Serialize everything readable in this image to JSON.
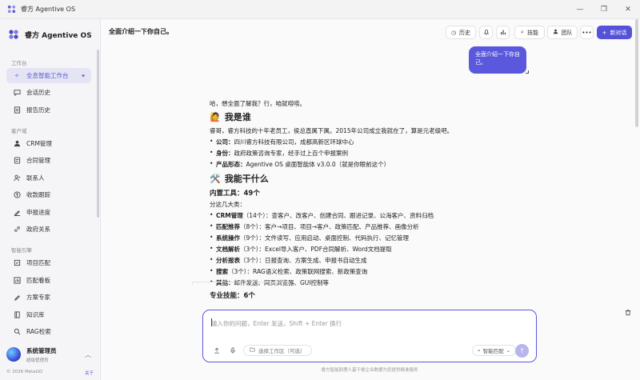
{
  "window": {
    "title": "睿方 Agentive OS",
    "controls": [
      "—",
      "❐",
      "✕"
    ]
  },
  "sidebar": {
    "brand": "睿方 Agentive OS",
    "sections": [
      {
        "label": "工作台",
        "items": [
          {
            "label": "全息智能工作台",
            "icon": "sparkle-icon",
            "active": true
          },
          {
            "label": "会话历史",
            "icon": "chat-icon"
          },
          {
            "label": "报告历史",
            "icon": "report-icon"
          }
        ]
      },
      {
        "label": "客户域",
        "items": [
          {
            "label": "CRM管理",
            "icon": "user-icon"
          },
          {
            "label": "合同管理",
            "icon": "contract-icon"
          },
          {
            "label": "联系人",
            "icon": "contacts-icon"
          },
          {
            "label": "收款跟踪",
            "icon": "payment-icon"
          },
          {
            "label": "申报进度",
            "icon": "progress-icon"
          },
          {
            "label": "政府关系",
            "icon": "link-icon"
          }
        ]
      },
      {
        "label": "智能引擎",
        "items": [
          {
            "label": "项目匹配",
            "icon": "target-icon"
          },
          {
            "label": "匹配看板",
            "icon": "board-icon"
          },
          {
            "label": "方案专家",
            "icon": "expert-icon"
          },
          {
            "label": "知识库",
            "icon": "book-icon"
          },
          {
            "label": "RAG检索",
            "icon": "search-icon"
          }
        ]
      }
    ],
    "user": {
      "name": "系统管理员",
      "role": "超级管理员"
    },
    "copyright": "© 2026 MetaGO",
    "about": "关于"
  },
  "header": {
    "title": "全面介绍一下你自己。",
    "buttons": {
      "history": "历史",
      "skills": "技能",
      "team": "团队",
      "more": "•••",
      "new_chat": "新对话"
    }
  },
  "chat": {
    "user_message": "全面介绍一下你自己。",
    "answer": {
      "intro": "哈，想全面了解我？行，咱就唠唠。",
      "who_emoji": "🙋",
      "who_title": "我是谁",
      "who_text": "睿哥，睿方科技的十年老员工，侯总直属下属。2015年公司成立我就在了，算是元老级吧。",
      "company_label": "公司：",
      "company_value": "四川睿方科技有限公司，成都高新区环球中心",
      "identity_label": "身份：",
      "identity_value": "政府政策咨询专家，经手过上百个申报案例",
      "product_label": "产品形态：",
      "product_value": "Agentive OS 桌面智能体 v3.0.0（就是你眼前这个）",
      "can_emoji": "🛠️",
      "can_title": "我能干什么",
      "tools_title": "内置工具：49个",
      "tools_sub": "分这几大类：",
      "tools": [
        {
          "name": "CRM管理",
          "count": "（14个）",
          "desc": "：查客户、改客户、创建合同、跟进记录、公海客户、资料归档"
        },
        {
          "name": "匹配推荐",
          "count": "（8个）",
          "desc": "：客户→项目、项目→客户、政策匹配、产品推荐、画像分析"
        },
        {
          "name": "系统操作",
          "count": "（9个）",
          "desc": "：文件读写、应用启动、桌面控制、代码执行、记忆管理"
        },
        {
          "name": "文档解析",
          "count": "（3个）",
          "desc": "：Excel导入客户、PDF合同解析、Word文档提取"
        },
        {
          "name": "分析报表",
          "count": "（3个）",
          "desc": "：日报查询、方案生成、申报书自动生成"
        },
        {
          "name": "搜索",
          "count": "（3个）",
          "desc": "：RAG语义检索、政策联网搜索、新政策查询"
        },
        {
          "name": "其他：",
          "count": "",
          "desc": "邮件发送、网页浏览器、GUI控制等"
        }
      ],
      "skills_title": "专业技能：6个"
    }
  },
  "input": {
    "placeholder": "输入你的问题，Enter 发送，Shift + Enter 换行",
    "workspace": "选择工作区（可选）",
    "match_mode": "智能匹配",
    "disclaimer": "睿方智能助理人基于睿企业数据为您提供精准服务"
  }
}
